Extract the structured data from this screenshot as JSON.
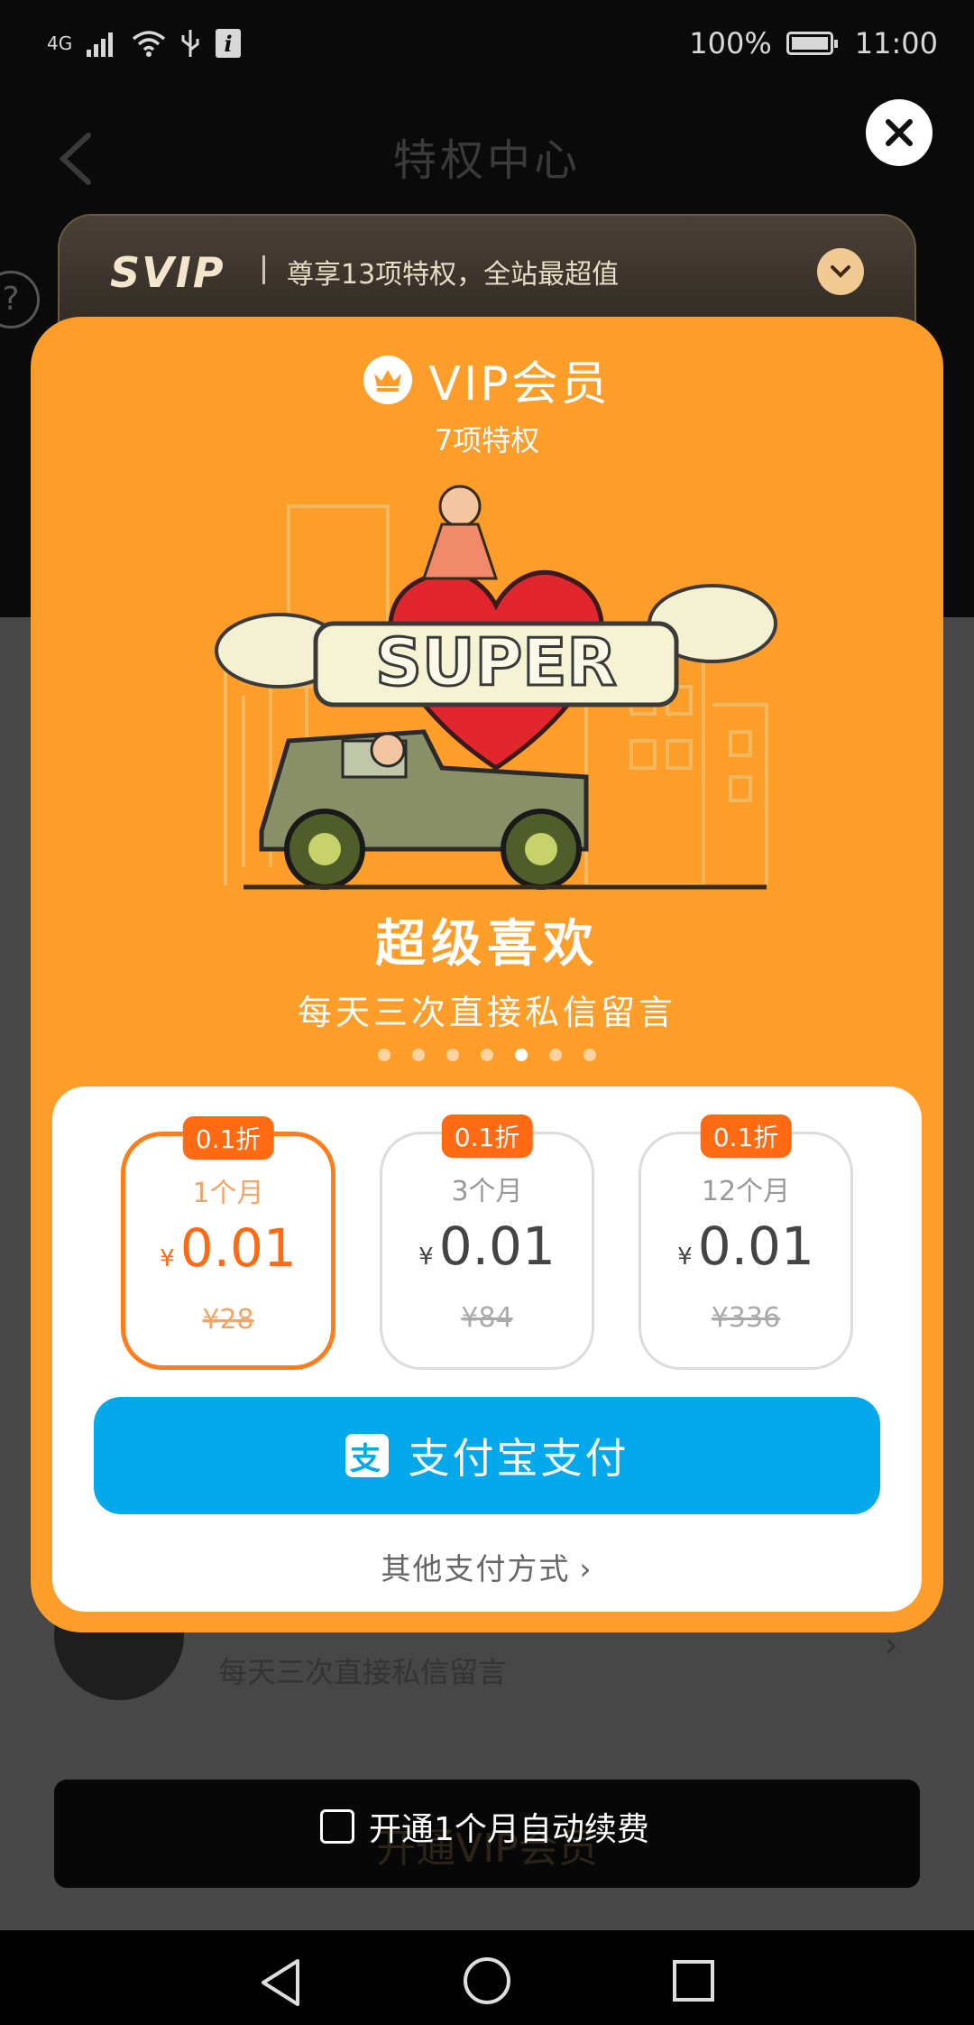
{
  "status_bar": {
    "network": "4G",
    "battery_percent": "100%",
    "time": "11:00"
  },
  "background": {
    "page_title": "特权中心",
    "svip": {
      "logo": "SVIP",
      "slogan": "尊享13项特权，全站最超值"
    },
    "list_item_text": "每天三次直接私信留言",
    "vip_button_label": "开通VIP会员",
    "auto_renew_label": "开通1个月自动续费"
  },
  "modal": {
    "title": "VIP会员",
    "subtitle": "7项特权",
    "illustration_text": "SUPER",
    "feature_title": "超级喜欢",
    "feature_desc": "每天三次直接私信留言",
    "carousel": {
      "count": 7,
      "active_index": 4
    },
    "plans": [
      {
        "badge": "0.1折",
        "duration": "1个月",
        "currency": "¥",
        "price": "0.01",
        "original": "¥28",
        "selected": true
      },
      {
        "badge": "0.1折",
        "duration": "3个月",
        "currency": "¥",
        "price": "0.01",
        "original": "¥84",
        "selected": false
      },
      {
        "badge": "0.1折",
        "duration": "12个月",
        "currency": "¥",
        "price": "0.01",
        "original": "¥336",
        "selected": false
      }
    ],
    "pay_button_label": "支付宝支付",
    "alipay_icon_glyph": "支",
    "other_pay_label": "其他支付方式"
  },
  "colors": {
    "modal_orange": "#fd9d2a",
    "selected_plan": "#ff6a13",
    "alipay_blue": "#06a8ec"
  },
  "icons": [
    "back-icon",
    "close-icon",
    "chevron-down-icon",
    "crown-icon",
    "alipay-icon",
    "chevron-right-icon",
    "help-icon"
  ]
}
